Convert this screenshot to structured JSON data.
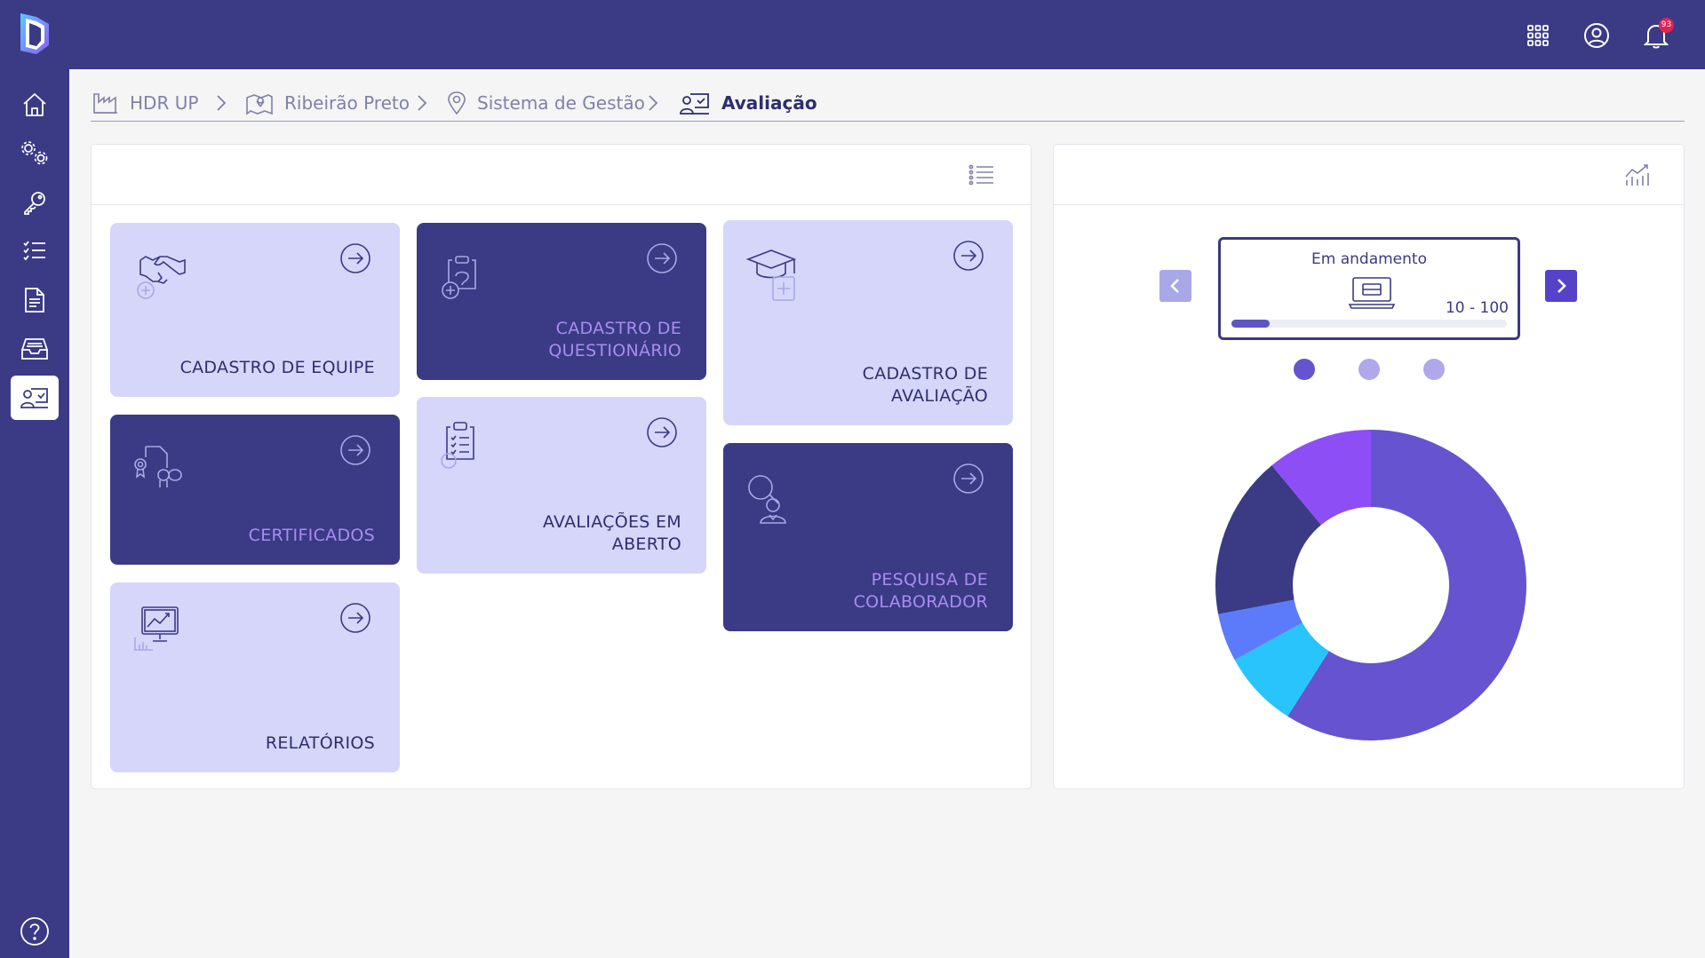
{
  "topbar": {
    "notifications_count": "93"
  },
  "breadcrumb": [
    {
      "label": "HDR UP"
    },
    {
      "label": "Ribeirão Preto"
    },
    {
      "label": "Sistema de Gestão"
    },
    {
      "label": "Avaliação"
    }
  ],
  "cards": {
    "equipe": "CADASTRO DE EQUIPE",
    "questionario": "CADASTRO DE\nQUESTIONÁRIO",
    "avaliacao": "CADASTRO DE\nAVALIAÇÃO",
    "certificados": "CERTIFICADOS",
    "abertas": "AVALIAÇÕES EM\nABERTO",
    "pesquisa": "PESQUISA DE\nCOLABORADOR",
    "relatorios": "RELATÓRIOS"
  },
  "status": {
    "title": "Em andamento",
    "range": "10 - 100",
    "progress": 0.14
  },
  "colors": {
    "primary": "#3a3a85",
    "light_card": "#d6d6fb",
    "accent": "#6553cf"
  },
  "chart_data": {
    "type": "pie",
    "donut": true,
    "slices": [
      {
        "value": 59,
        "color": "#6553cf"
      },
      {
        "value": 8,
        "color": "#28c4fb"
      },
      {
        "value": 5,
        "color": "#5c7bfa"
      },
      {
        "value": 17,
        "color": "#3a3a85"
      },
      {
        "value": 11,
        "color": "#8d4ef6"
      }
    ]
  }
}
